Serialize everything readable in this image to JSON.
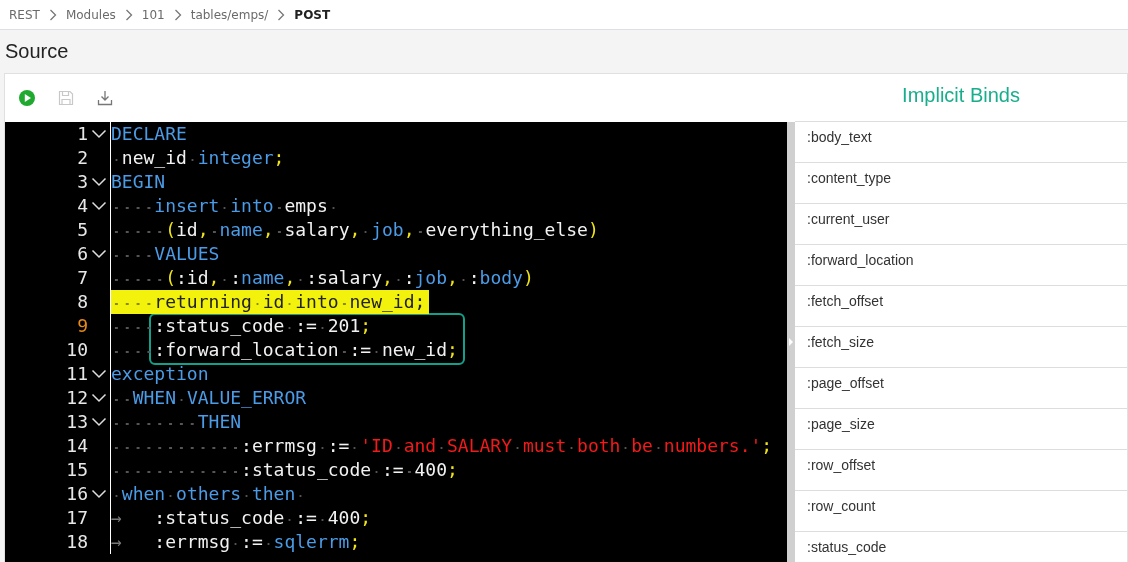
{
  "breadcrumb": [
    {
      "label": "REST",
      "current": false
    },
    {
      "label": "Modules",
      "current": false
    },
    {
      "label": "101",
      "current": false
    },
    {
      "label": "tables/emps/",
      "current": false
    },
    {
      "label": "POST",
      "current": true
    }
  ],
  "section_title": "Source",
  "toolbar": [
    {
      "kind": "run",
      "disabled": false
    },
    {
      "kind": "save",
      "disabled": true
    },
    {
      "kind": "download",
      "disabled": false
    }
  ],
  "editor": {
    "lines": [
      {
        "number": "1",
        "foldable": true,
        "current": false,
        "highlighted": false,
        "boxed": false,
        "tokens": [
          {
            "text": "DECLARE",
            "kind": "keyword"
          }
        ]
      },
      {
        "number": "2",
        "foldable": false,
        "current": false,
        "highlighted": false,
        "boxed": false,
        "tokens": [
          {
            "text": " new_id ",
            "kind": "plain"
          },
          {
            "text": "integer",
            "kind": "keyword"
          },
          {
            "text": ";",
            "kind": "punct"
          }
        ]
      },
      {
        "number": "3",
        "foldable": true,
        "current": false,
        "highlighted": false,
        "boxed": false,
        "tokens": [
          {
            "text": "BEGIN",
            "kind": "keyword"
          }
        ]
      },
      {
        "number": "4",
        "foldable": true,
        "current": false,
        "highlighted": false,
        "boxed": false,
        "tokens": [
          {
            "text": "    insert into ",
            "kind": "keyword"
          },
          {
            "text": "emps ",
            "kind": "plain"
          }
        ]
      },
      {
        "number": "5",
        "foldable": false,
        "current": false,
        "highlighted": false,
        "boxed": false,
        "tokens": [
          {
            "text": "     (",
            "kind": "punct"
          },
          {
            "text": "id",
            "kind": "plain"
          },
          {
            "text": ", ",
            "kind": "punct"
          },
          {
            "text": "name",
            "kind": "keyword"
          },
          {
            "text": ", ",
            "kind": "punct"
          },
          {
            "text": "salary",
            "kind": "plain"
          },
          {
            "text": ", ",
            "kind": "punct"
          },
          {
            "text": "job",
            "kind": "keyword"
          },
          {
            "text": ", ",
            "kind": "punct"
          },
          {
            "text": "everything_else",
            "kind": "plain"
          },
          {
            "text": ")",
            "kind": "punct"
          }
        ]
      },
      {
        "number": "6",
        "foldable": true,
        "current": false,
        "highlighted": false,
        "boxed": false,
        "tokens": [
          {
            "text": "    VALUES",
            "kind": "keyword"
          }
        ]
      },
      {
        "number": "7",
        "foldable": false,
        "current": false,
        "highlighted": false,
        "boxed": false,
        "tokens": [
          {
            "text": "     (",
            "kind": "punct"
          },
          {
            "text": ":id",
            "kind": "plain"
          },
          {
            "text": ", ",
            "kind": "punct"
          },
          {
            "text": ":",
            "kind": "plain"
          },
          {
            "text": "name",
            "kind": "keyword"
          },
          {
            "text": ", ",
            "kind": "punct"
          },
          {
            "text": ":salary",
            "kind": "plain"
          },
          {
            "text": ", ",
            "kind": "punct"
          },
          {
            "text": ":",
            "kind": "plain"
          },
          {
            "text": "job",
            "kind": "keyword"
          },
          {
            "text": ", ",
            "kind": "punct"
          },
          {
            "text": ":",
            "kind": "plain"
          },
          {
            "text": "body",
            "kind": "keyword"
          },
          {
            "text": ")",
            "kind": "punct"
          }
        ]
      },
      {
        "number": "8",
        "foldable": false,
        "current": false,
        "highlighted": true,
        "boxed": false,
        "tokens": [
          {
            "text": "    returning id into new_id;",
            "kind": "plain"
          }
        ]
      },
      {
        "number": "9",
        "foldable": false,
        "current": true,
        "highlighted": false,
        "boxed": true,
        "tokens": [
          {
            "text": "    :status_code := 201",
            "kind": "plain"
          },
          {
            "text": ";",
            "kind": "punct"
          }
        ]
      },
      {
        "number": "10",
        "foldable": false,
        "current": false,
        "highlighted": false,
        "boxed": true,
        "tokens": [
          {
            "text": "    :forward_location := new_id",
            "kind": "plain"
          },
          {
            "text": ";",
            "kind": "punct"
          }
        ]
      },
      {
        "number": "11",
        "foldable": true,
        "current": false,
        "highlighted": false,
        "boxed": false,
        "tokens": [
          {
            "text": "exception",
            "kind": "keyword"
          }
        ]
      },
      {
        "number": "12",
        "foldable": true,
        "current": false,
        "highlighted": false,
        "boxed": false,
        "tokens": [
          {
            "text": "  WHEN VALUE_ERROR",
            "kind": "keyword"
          }
        ]
      },
      {
        "number": "13",
        "foldable": true,
        "current": false,
        "highlighted": false,
        "boxed": false,
        "tokens": [
          {
            "text": "        THEN",
            "kind": "keyword"
          }
        ]
      },
      {
        "number": "14",
        "foldable": false,
        "current": false,
        "highlighted": false,
        "boxed": false,
        "tokens": [
          {
            "text": "            :errmsg := ",
            "kind": "plain"
          },
          {
            "text": "'ID and SALARY must both be numbers.'",
            "kind": "string"
          },
          {
            "text": ";",
            "kind": "punct"
          }
        ]
      },
      {
        "number": "15",
        "foldable": false,
        "current": false,
        "highlighted": false,
        "boxed": false,
        "tokens": [
          {
            "text": "            :status_code := 400",
            "kind": "plain"
          },
          {
            "text": ";",
            "kind": "punct"
          }
        ]
      },
      {
        "number": "16",
        "foldable": true,
        "current": false,
        "highlighted": false,
        "boxed": false,
        "tokens": [
          {
            "text": " when others then ",
            "kind": "keyword"
          }
        ]
      },
      {
        "number": "17",
        "foldable": false,
        "current": false,
        "highlighted": false,
        "boxed": false,
        "tokens": [
          {
            "text": "→",
            "kind": "tab"
          },
          {
            "text": ":status_code := 400",
            "kind": "plain"
          },
          {
            "text": ";",
            "kind": "punct"
          }
        ]
      },
      {
        "number": "18",
        "foldable": false,
        "current": false,
        "highlighted": false,
        "boxed": false,
        "tokens": [
          {
            "text": "→",
            "kind": "tab"
          },
          {
            "text": ":errmsg := ",
            "kind": "plain"
          },
          {
            "text": "sqlerrm",
            "kind": "keyword"
          },
          {
            "text": ";",
            "kind": "punct"
          }
        ]
      }
    ]
  },
  "implicit_binds": {
    "title": "Implicit Binds",
    "items": [
      ":body_text",
      ":content_type",
      ":current_user",
      ":forward_location",
      ":fetch_offset",
      ":fetch_size",
      ":page_offset",
      ":page_size",
      ":row_offset",
      ":row_count",
      ":status_code"
    ]
  }
}
